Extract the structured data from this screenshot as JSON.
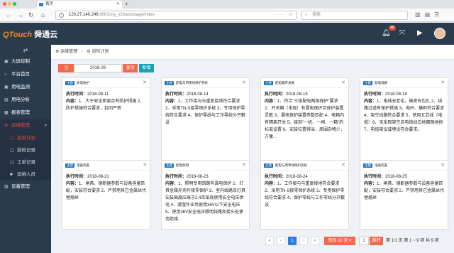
{
  "browser": {
    "tab_title": "首页",
    "url": "120.27.140.246:8081/sty_v2/backstage/index",
    "url_host": "120.27.140.246",
    "url_path": ":8081/sty_v2/backstage/index",
    "search_placeholder": "搜索"
  },
  "header": {
    "logo_brand": "QTouch",
    "logo_cn": "舜通云",
    "notif_count": "48"
  },
  "sidebar": {
    "items": [
      {
        "label": "大屏控制",
        "icon": "monitor-icon"
      },
      {
        "label": "平台首页",
        "icon": "home-icon"
      },
      {
        "label": "用电监测",
        "icon": "monitor-icon"
      },
      {
        "label": "用电分析",
        "icon": "analysis-icon"
      },
      {
        "label": "报表管理",
        "icon": "report-icon"
      },
      {
        "label": "运维管理",
        "icon": "gear-icon"
      }
    ],
    "subitems": [
      {
        "label": "巡检计划"
      },
      {
        "label": "巡检记录"
      },
      {
        "label": "工单记录"
      },
      {
        "label": "运维人员"
      }
    ],
    "last_item": {
      "label": "设备管理"
    }
  },
  "breadcrumb": {
    "root": "运维管理",
    "current": "巡检计划"
  },
  "toolbar": {
    "date_value": "2018-08",
    "query_label": "查询",
    "add_label": "新增"
  },
  "labels": {
    "exec_time": "执行时间：",
    "content": "内容："
  },
  "cards": [
    {
      "tag": "主题",
      "name": "防电防护",
      "date": "2018-08-11",
      "content": "1、大于安全距离且有防护措施 2、防护措施符合要求，封闭严密"
    },
    {
      "tag": "主题",
      "name": "配电与用零线保护系统",
      "date": "2018-08-14",
      "content": "1、工作接与与重复接地符合要求 2、采用TN-S接零保护系统 3、专用保护零线符合要求 4、保护零线与工作零线分开敷设"
    },
    {
      "tag": "主题",
      "name": "配电箱开关箱",
      "date": "2018-08-15",
      "content": "1、符合\"三级配电两级保护\"要求 2、开关箱（末级）有漏电保护且保护装置灵敏 3、漏电保护装置参数匹配 4、电箱内有隔离开关 5、接到\"一机、一闸、一箱\"的标准设置 6、安装位置得当，周围杂物少，方便..."
    },
    {
      "tag": "主题",
      "name": "配电线路",
      "date": "2018-08-18",
      "content": "1、电线无老化，破皮有包扎 2、线路过道有保护措施 3、电杆、横担符合要求 4、架空线路符合要求 5、使用五芯线（电缆）6、末采取架空且电缆线沿地面随地拖7、电缆架设或埋设符合要求。"
    },
    {
      "tag": "主题",
      "name": "电器装置",
      "date": "2018-08-21",
      "content": "1、闸具、熔断器参数与设备容量匹配，安装符合要求 2、严禁用其它金属丝代替熔丝"
    },
    {
      "tag": "主题",
      "name": "配电照明",
      "date": "2018-08-23",
      "content": "1、照明专用回路有漏电保护 2、灯具金属外壳作接零保护 3、室内线路及灯具安装高度应高于2.4且架底使用安全电压供电 4、潮湿作业场使用36V以下安全电压 5、使用36V安全电压照明线路和接头处使用绝缘..."
    },
    {
      "tag": "主题",
      "name": "配电与用零线保护系统",
      "date": "2018-08-24",
      "content": "1、工作接与与重复接地符合要求 2、采用TN-S接零保护系统 3、专用保护零线符合要求 4、保护零线与工作零线分开敷设"
    },
    {
      "tag": "主题",
      "name": "电器装置",
      "date": "2018-08-25",
      "content": "1、闸具、熔断器参数与设备容量匹配，安装符合要求 2、严禁用其它金属丝代替熔丝"
    }
  ],
  "pagination": {
    "first": "«",
    "prev": "‹",
    "current": "1",
    "next": "›",
    "last": "»",
    "per_page": "每页 10 条 ▾",
    "goto_value": "1",
    "go_label": "跳转",
    "info": "第 1/1 页    第 1 ~ 9 项    共 9 项"
  },
  "colors": {
    "header_bg": "#2b3b4e",
    "accent_red": "#ee6b4d",
    "accent_blue": "#2a7de1",
    "add_teal": "#17a2b8"
  }
}
